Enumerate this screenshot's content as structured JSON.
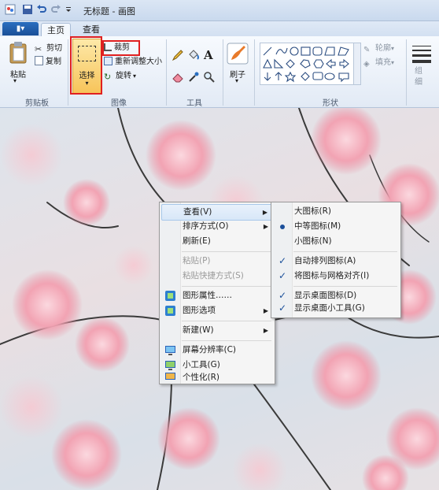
{
  "window": {
    "title": "无标题 - 画图"
  },
  "tabs": {
    "app_menu": "▮▾",
    "home": "主页",
    "view": "查看"
  },
  "ribbon": {
    "clipboard": {
      "paste": "粘贴",
      "cut": "剪切",
      "copy": "复制",
      "group": "剪贴板"
    },
    "image": {
      "select": "选择",
      "crop": "裁剪",
      "resize": "重新调整大小",
      "rotate": "旋转",
      "group": "图像"
    },
    "tools": {
      "group": "工具",
      "text_glyph": "A"
    },
    "brushes": {
      "label": "刷子"
    },
    "shapes": {
      "outline": "轮廓",
      "fill": "填充",
      "group": "形状"
    },
    "size": {
      "label": "组细"
    }
  },
  "context_menu": {
    "items": [
      {
        "label": "查看(V)",
        "arrow": "▶"
      },
      {
        "label": "排序方式(O)",
        "arrow": "▶"
      },
      {
        "label": "刷新(E)"
      },
      {
        "label": "粘贴(P)"
      },
      {
        "label": "粘贴快捷方式(S)"
      },
      {
        "label": "图形属性……"
      },
      {
        "label": "图形选项",
        "arrow": "▶"
      },
      {
        "label": "新建(W)",
        "arrow": "▶"
      },
      {
        "label": "屏幕分辨率(C)"
      },
      {
        "label": "小工具(G)"
      },
      {
        "label": "个性化(R)"
      }
    ]
  },
  "submenu": {
    "items": [
      {
        "label": "大图标(R)"
      },
      {
        "label": "中等图标(M)"
      },
      {
        "label": "小图标(N)"
      },
      {
        "label": "自动排列图标(A)",
        "check": "✓"
      },
      {
        "label": "将图标与网格对齐(I)",
        "check": "✓"
      },
      {
        "label": "显示桌面图标(D)",
        "check": "✓"
      },
      {
        "label": "显示桌面小工具(G)",
        "check": "✓"
      }
    ]
  },
  "colors": {
    "accent": "#1a4f97",
    "highlight": "#fbd46a",
    "annotation": "#e02020",
    "blossom": "#f2a3b3"
  }
}
